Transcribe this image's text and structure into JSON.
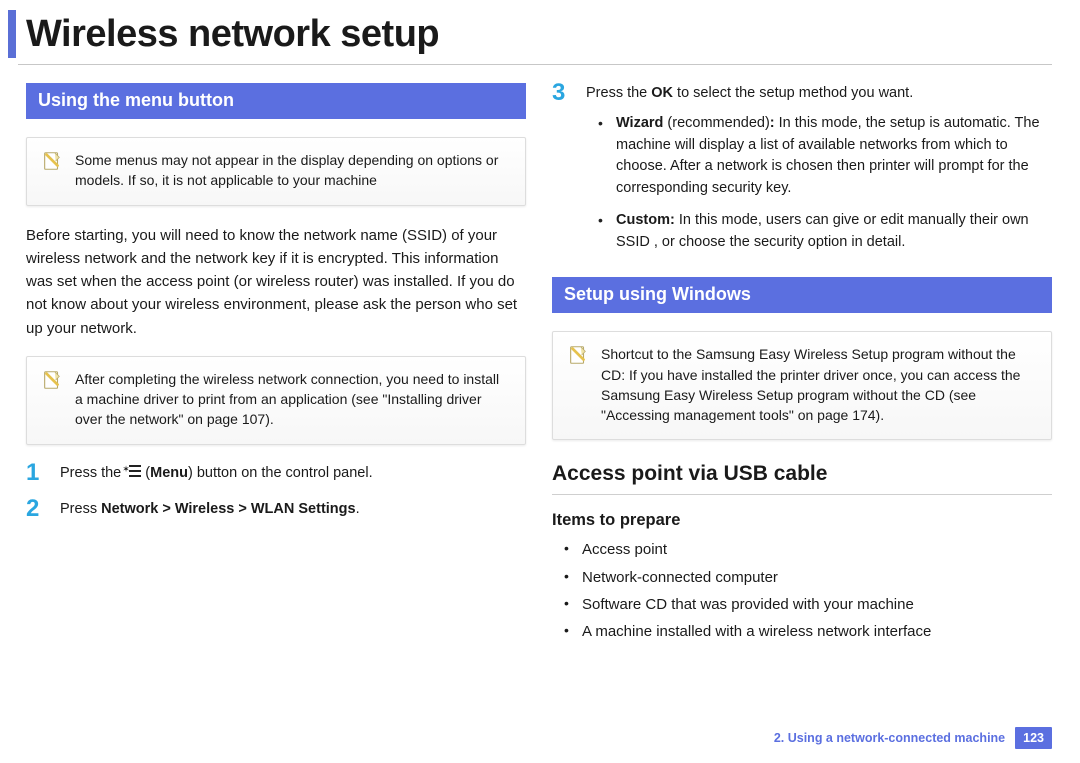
{
  "title": "Wireless network setup",
  "left": {
    "section_heading": "Using the menu button",
    "note1": "Some menus may not appear in the display depending on options or models. If so, it is not applicable to your machine",
    "intro": "Before starting, you will need to know the network name (SSID) of your wireless network and the network key if it is encrypted. This information was set when the access point (or wireless router) was installed. If you do not know about your wireless environment, please ask the person who set up your network.",
    "note2": "After completing the wireless network connection, you need to install a machine driver to print from an application (see \"Installing driver over the network\" on page 107).",
    "step1_pre": "Press the ",
    "step1_menu_label": "Menu",
    "step1_post": ") button on the control panel.",
    "step2_pre": "Press ",
    "step2_bold": "Network > Wireless > WLAN Settings",
    "step2_post": "."
  },
  "right": {
    "step3_pre": "Press the ",
    "step3_bold": "OK",
    "step3_post": " to select the setup method you want.",
    "wizard_label": "Wizard",
    "wizard_recommended": " (recommended)",
    "wizard_colon": ":",
    "wizard_text": " In this mode, the setup is automatic. The machine will display a list of available networks from which to choose. After a network is chosen then printer will prompt for the corresponding security key.",
    "custom_label": "Custom:",
    "custom_text": " In this mode, users can give or edit manually their own SSID , or choose the security option in detail.",
    "section_heading": "Setup using Windows",
    "note": "Shortcut to the Samsung Easy Wireless Setup program without the CD: If you have installed the printer driver once, you can access the Samsung Easy Wireless Setup program without the CD (see \"Accessing management tools\" on page 174).",
    "h2": "Access point via USB cable",
    "h3": "Items to prepare",
    "prep": [
      "Access point",
      "Network-connected computer",
      "Software CD that was provided with your machine",
      "A machine installed with a wireless network interface"
    ]
  },
  "footer": {
    "chapter": "2.  Using a network-connected machine",
    "page": "123"
  }
}
